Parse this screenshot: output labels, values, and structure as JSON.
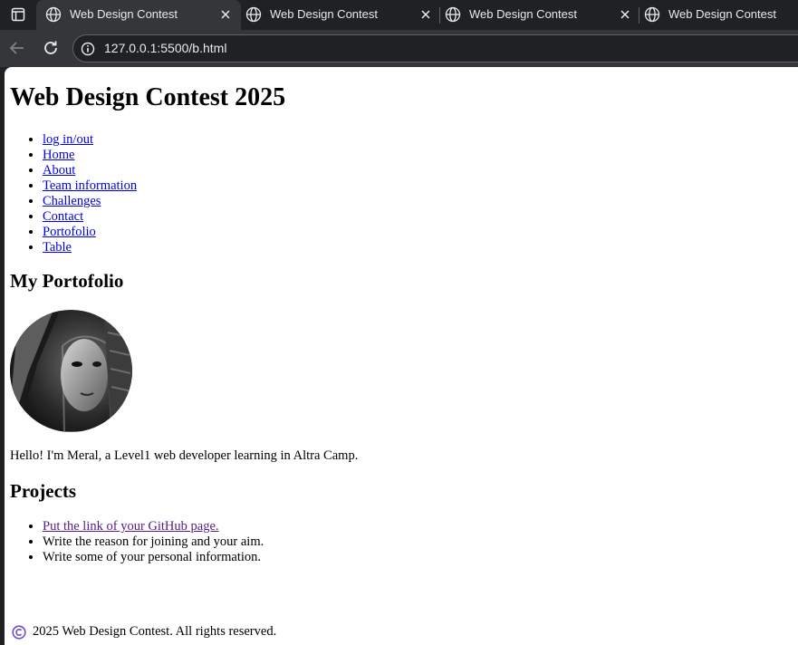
{
  "browser": {
    "tabs": [
      {
        "title": "Web Design Contest",
        "active": true
      },
      {
        "title": "Web Design Contest",
        "active": false
      },
      {
        "title": "Web Design Contest",
        "active": false
      },
      {
        "title": "Web Design Contest",
        "active": false
      }
    ],
    "url": "127.0.0.1:5500/b.html"
  },
  "page": {
    "heading": "Web Design Contest 2025",
    "nav": [
      "log in/out",
      "Home",
      "About",
      "Team information",
      "Challenges",
      "Contact",
      "Portofolio",
      "Table"
    ],
    "portfolio_heading": "My Portofolio",
    "intro": "Hello! I'm Meral, a Level1 web developer learning in Altra Camp.",
    "projects_heading": "Projects",
    "projects": {
      "link": "Put the link of your GitHub page.",
      "item2": "Write the reason for joining and your aim.",
      "item3": "Write some of your personal information."
    },
    "footer": "2025 Web Design Contest. All rights reserved."
  },
  "colors": {
    "link": "#0000ee",
    "visited_link": "#551a8b",
    "copyright_icon": "#6a4fc9",
    "tabstrip": "#202124",
    "toolbar": "#35363a"
  },
  "icons": [
    "tab-search-icon",
    "globe-icon",
    "close-icon",
    "back-icon",
    "reload-icon",
    "info-icon",
    "copyright-icon"
  ]
}
